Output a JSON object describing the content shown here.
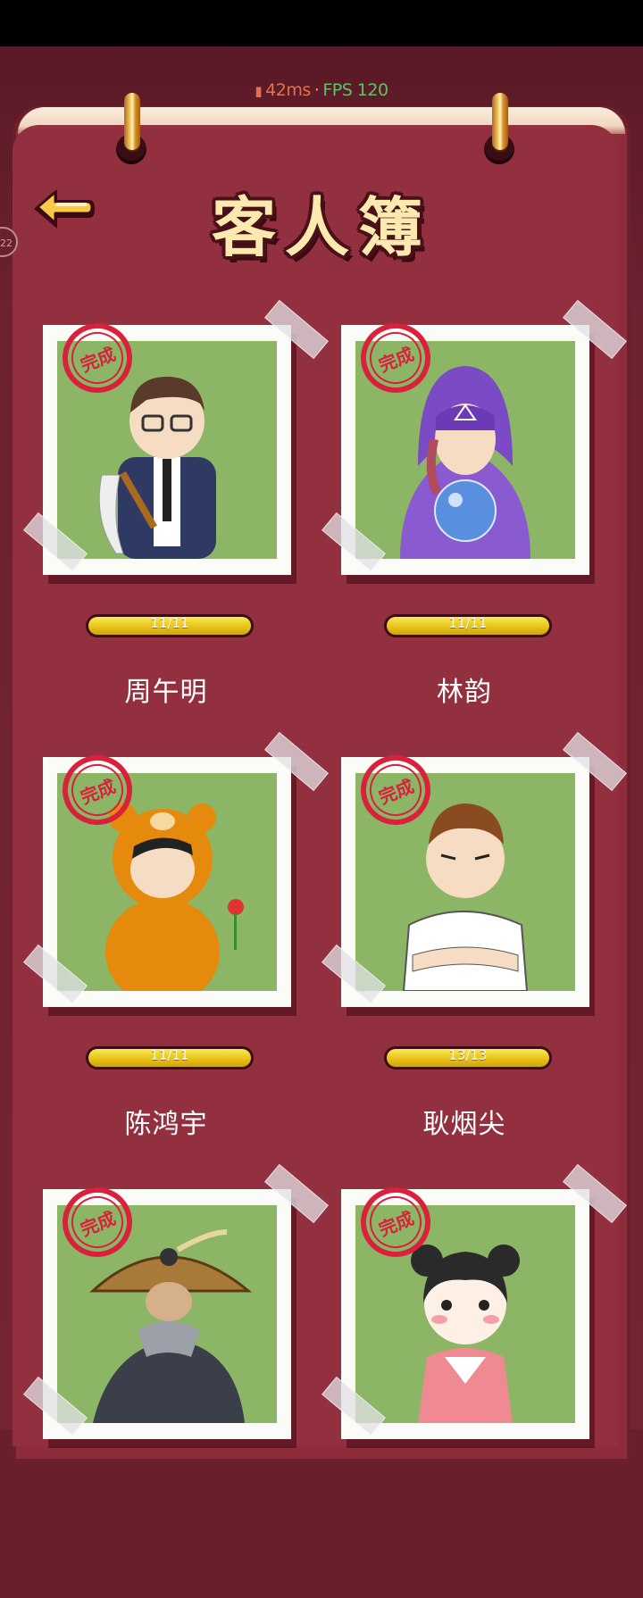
{
  "perf": {
    "signal_icon": "signal-bars-icon",
    "latency": "42ms",
    "separator": "·",
    "fps": "FPS 120"
  },
  "header": {
    "title": "客人簿",
    "back_icon": "back-arrow-icon"
  },
  "side_bubble": "22",
  "colors": {
    "page": "#93303f",
    "stamp": "#d9213d",
    "photo_bg": "#8cb565",
    "progress": "#e9c21a"
  },
  "guests": [
    {
      "name": "周午明",
      "stamp": "完成",
      "progress": "11/11",
      "progress_fraction": 1.0
    },
    {
      "name": "林韵",
      "stamp": "完成",
      "progress": "11/11",
      "progress_fraction": 1.0
    },
    {
      "name": "陈鸿宇",
      "stamp": "完成",
      "progress": "11/11",
      "progress_fraction": 1.0
    },
    {
      "name": "耿烟尖",
      "stamp": "完成",
      "progress": "13/13",
      "progress_fraction": 1.0
    },
    {
      "name": "",
      "stamp": "完成",
      "progress": "",
      "progress_fraction": 1.0
    },
    {
      "name": "",
      "stamp": "完成",
      "progress": "",
      "progress_fraction": 1.0
    }
  ]
}
